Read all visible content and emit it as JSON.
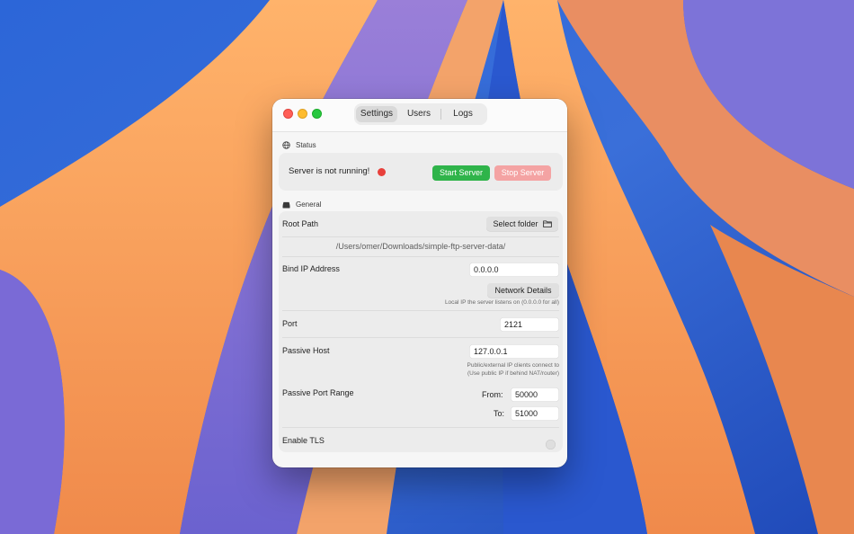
{
  "window": {
    "tabs": [
      {
        "label": "Settings",
        "active": true
      },
      {
        "label": "Users",
        "active": false
      },
      {
        "label": "Logs",
        "active": false
      }
    ]
  },
  "status": {
    "section_title": "Status",
    "icon": "globe-icon",
    "message": "Server is not running!",
    "indicator_color": "#e8403b",
    "start_label": "Start Server",
    "stop_label": "Stop Server",
    "stop_enabled": false
  },
  "general": {
    "section_title": "General",
    "icon": "drive-icon",
    "root_path_label": "Root Path",
    "select_folder_label": "Select folder",
    "root_path_value": "/Users/omer/Downloads/simple-ftp-server-data/",
    "bind_ip_label": "Bind IP Address",
    "bind_ip_value": "0.0.0.0",
    "network_details_label": "Network Details",
    "bind_ip_hint": "Local IP the server listens on (0.0.0.0 for all)",
    "port_label": "Port",
    "port_value": "2121",
    "passive_host_label": "Passive Host",
    "passive_host_value": "127.0.0.1",
    "passive_host_hint_1": "Public/external IP clients connect to",
    "passive_host_hint_2": "(Use public IP if behind NAT/router)",
    "passive_range_label": "Passive Port Range",
    "from_label": "From:",
    "from_value": "50000",
    "to_label": "To:",
    "to_value": "51000",
    "tls_label": "Enable TLS",
    "tls_enabled": false
  },
  "colors": {
    "start_button": "#2fb44a",
    "stop_button_disabled": "#f4a3a3"
  }
}
